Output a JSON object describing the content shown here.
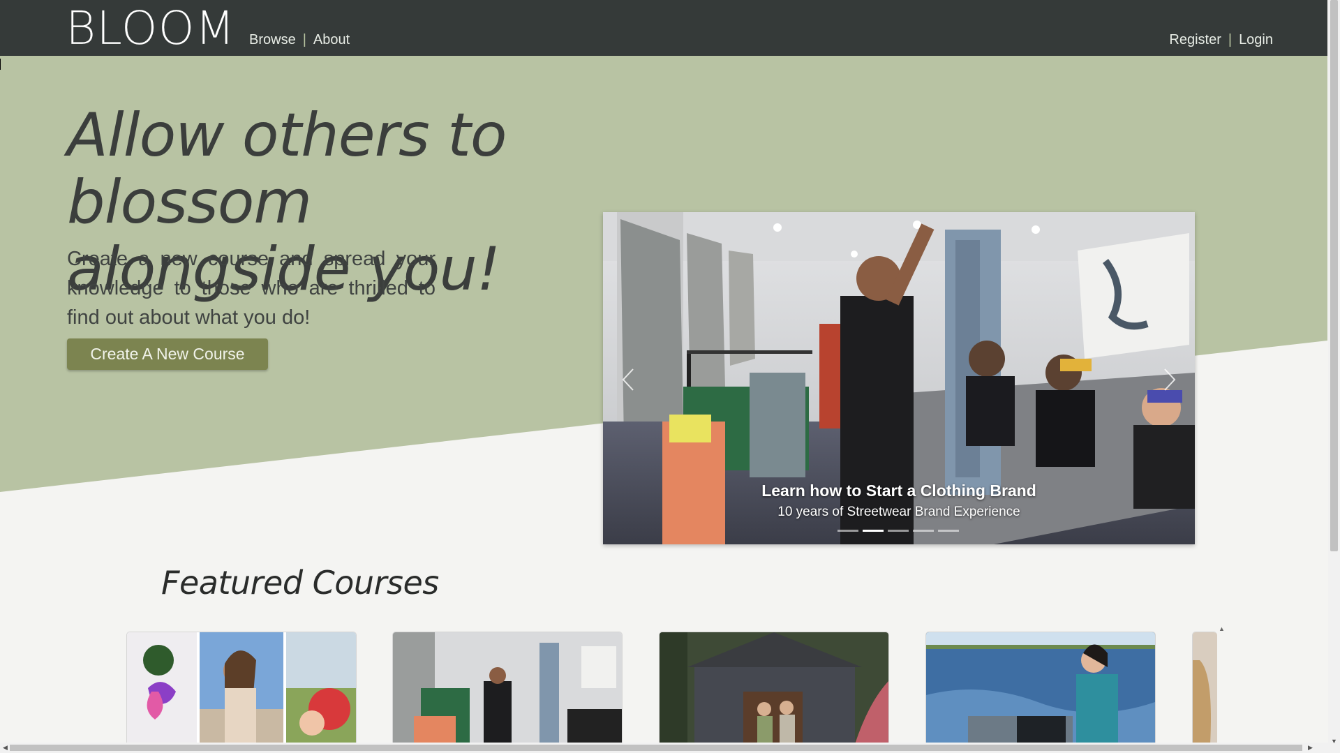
{
  "header": {
    "logo": "BLOOM",
    "nav_left": [
      {
        "label": "Browse"
      },
      {
        "label": "About"
      }
    ],
    "nav_right": [
      {
        "label": "Register"
      },
      {
        "label": "Login"
      }
    ],
    "separator": "|"
  },
  "hero": {
    "headline": "Allow others to blossom alongside you!",
    "subtext": "Create a new course and spread your knowledge to those who are thrilled to find out about what you do!",
    "cta_label": "Create A New Course"
  },
  "carousel": {
    "caption_title": "Learn how to Start a Clothing Brand",
    "caption_subtitle": "10 years of Streetwear Brand Experience",
    "slide_count": 5,
    "active_index": 1
  },
  "featured": {
    "title": "Featured Courses",
    "cards": [
      {
        "image": "flowers-collage-photo"
      },
      {
        "image": "clothing-brand-photo"
      },
      {
        "image": "cabin-couple-photo"
      },
      {
        "image": "boat-scuba-photo"
      },
      {
        "image": "partial-card-photo"
      }
    ]
  },
  "colors": {
    "header_bg": "#353a39",
    "hero_green": "#b8c3a3",
    "button_olive": "#7c8450",
    "page_bg": "#f4f4f2"
  }
}
